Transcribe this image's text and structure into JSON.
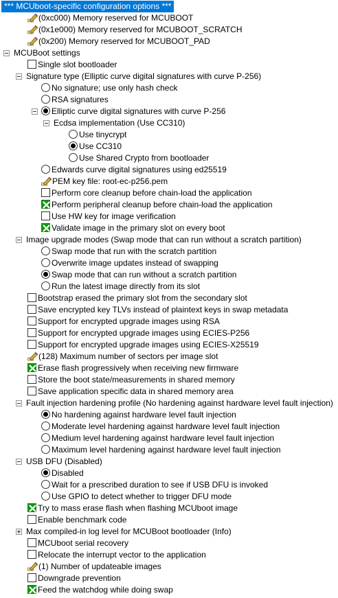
{
  "rows": [
    {
      "label": "*** MCUboot-specific configuration options ***",
      "kind": "header",
      "depth": 0
    },
    {
      "label": "(0xc000) Memory reserved for MCUBOOT",
      "kind": "value",
      "depth": 1
    },
    {
      "label": "(0x1e000) Memory reserved for MCUBOOT_SCRATCH",
      "kind": "value",
      "depth": 1
    },
    {
      "label": "(0x200) Memory reserved for MCUBOOT_PAD",
      "kind": "value",
      "depth": 1
    },
    {
      "label": "MCUBoot settings",
      "kind": "menu",
      "expanded": true,
      "depth": 0
    },
    {
      "label": "Single slot bootloader",
      "kind": "check",
      "checked": false,
      "depth": 1
    },
    {
      "label": "Signature type (Elliptic curve digital signatures with curve P-256)",
      "kind": "menu",
      "expanded": true,
      "depth": 1
    },
    {
      "label": "No signature; use only hash check",
      "kind": "radio",
      "selected": false,
      "depth": 2
    },
    {
      "label": "RSA signatures",
      "kind": "radio",
      "selected": false,
      "depth": 2
    },
    {
      "label": "Elliptic curve digital signatures with curve P-256",
      "kind": "radio",
      "selected": true,
      "expanded": true,
      "depth": 2
    },
    {
      "label": "Ecdsa implementation (Use CC310)",
      "kind": "menu",
      "expanded": true,
      "depth": 3
    },
    {
      "label": "Use tinycrypt",
      "kind": "radio",
      "selected": false,
      "depth": 4
    },
    {
      "label": "Use CC310",
      "kind": "radio",
      "selected": true,
      "depth": 4
    },
    {
      "label": "Use Shared Crypto from bootloader",
      "kind": "radio",
      "selected": false,
      "depth": 4
    },
    {
      "label": "Edwards curve digital signatures using ed25519",
      "kind": "radio",
      "selected": false,
      "depth": 2
    },
    {
      "label": "PEM key file: root-ec-p256.pem",
      "kind": "value",
      "depth": 2
    },
    {
      "label": "Perform core cleanup before chain-load the application",
      "kind": "check",
      "checked": false,
      "depth": 2
    },
    {
      "label": "Perform peripheral cleanup before chain-load the application",
      "kind": "check",
      "checked": true,
      "depth": 2
    },
    {
      "label": "Use HW key for image verification",
      "kind": "check",
      "checked": false,
      "depth": 2
    },
    {
      "label": "Validate image in the primary slot on every boot",
      "kind": "check",
      "checked": true,
      "depth": 2
    },
    {
      "label": "Image upgrade modes (Swap mode that can run without a scratch partition)",
      "kind": "menu",
      "expanded": true,
      "depth": 1
    },
    {
      "label": "Swap mode that run with the scratch partition",
      "kind": "radio",
      "selected": false,
      "depth": 2
    },
    {
      "label": "Overwrite image updates instead of swapping",
      "kind": "radio",
      "selected": false,
      "depth": 2
    },
    {
      "label": "Swap mode that can run without a scratch partition",
      "kind": "radio",
      "selected": true,
      "depth": 2
    },
    {
      "label": "Run the latest image directly from its slot",
      "kind": "radio",
      "selected": false,
      "depth": 2
    },
    {
      "label": "Bootstrap erased the primary slot from the secondary slot",
      "kind": "check",
      "checked": false,
      "depth": 1
    },
    {
      "label": "Save encrypted key TLVs instead of plaintext keys in swap metadata",
      "kind": "check",
      "checked": false,
      "depth": 1
    },
    {
      "label": "Support for encrypted upgrade images using RSA",
      "kind": "check",
      "checked": false,
      "depth": 1
    },
    {
      "label": "Support for encrypted upgrade images using ECIES-P256",
      "kind": "check",
      "checked": false,
      "depth": 1
    },
    {
      "label": "Support for encrypted upgrade images using ECIES-X25519",
      "kind": "check",
      "checked": false,
      "depth": 1
    },
    {
      "label": "(128) Maximum number of sectors per image slot",
      "kind": "value",
      "depth": 1
    },
    {
      "label": "Erase flash progressively when receiving new firmware",
      "kind": "check",
      "checked": true,
      "depth": 1
    },
    {
      "label": "Store the boot state/measurements in shared memory",
      "kind": "check",
      "checked": false,
      "depth": 1
    },
    {
      "label": "Save application specific data in shared memory area",
      "kind": "check",
      "checked": false,
      "depth": 1
    },
    {
      "label": "Fault injection hardening profile (No hardening against hardware level fault injection)",
      "kind": "menu",
      "expanded": true,
      "depth": 1
    },
    {
      "label": "No hardening against hardware level fault injection",
      "kind": "radio",
      "selected": true,
      "depth": 2
    },
    {
      "label": "Moderate level hardening against hardware level fault injection",
      "kind": "radio",
      "selected": false,
      "depth": 2
    },
    {
      "label": "Medium level hardening against hardware level fault injection",
      "kind": "radio",
      "selected": false,
      "depth": 2
    },
    {
      "label": "Maximum level hardening against hardware level fault injection",
      "kind": "radio",
      "selected": false,
      "depth": 2
    },
    {
      "label": "USB DFU (Disabled)",
      "kind": "menu",
      "expanded": true,
      "depth": 1
    },
    {
      "label": "Disabled",
      "kind": "radio",
      "selected": true,
      "depth": 2
    },
    {
      "label": "Wait for a prescribed duration to see if USB DFU is invoked",
      "kind": "radio",
      "selected": false,
      "depth": 2
    },
    {
      "label": "Use GPIO to detect whether to trigger DFU mode",
      "kind": "radio",
      "selected": false,
      "depth": 2
    },
    {
      "label": "Try to mass erase flash when flashing MCUboot image",
      "kind": "check",
      "checked": true,
      "depth": 1
    },
    {
      "label": "Enable benchmark code",
      "kind": "check",
      "checked": false,
      "depth": 1
    },
    {
      "label": "Max compiled-in log level for MCUBoot bootloader (Info)",
      "kind": "menu",
      "expanded": false,
      "depth": 1
    },
    {
      "label": "MCUboot serial recovery",
      "kind": "check",
      "checked": false,
      "depth": 1
    },
    {
      "label": "Relocate the interrupt vector to the application",
      "kind": "check",
      "checked": false,
      "depth": 1
    },
    {
      "label": "(1) Number of updateable images",
      "kind": "value",
      "depth": 1
    },
    {
      "label": "Downgrade prevention",
      "kind": "check",
      "checked": false,
      "depth": 1
    },
    {
      "label": "Feed the watchdog while doing swap",
      "kind": "check",
      "checked": true,
      "depth": 1
    }
  ],
  "colors": {
    "selection": "#0078d7",
    "check_green": "#0b9d0b",
    "pencil": "#c8a23a"
  },
  "icons": {
    "value": "pencil-icon",
    "check": "checkbox-icon",
    "radio": "radio-icon",
    "menu": "expander-icon"
  }
}
